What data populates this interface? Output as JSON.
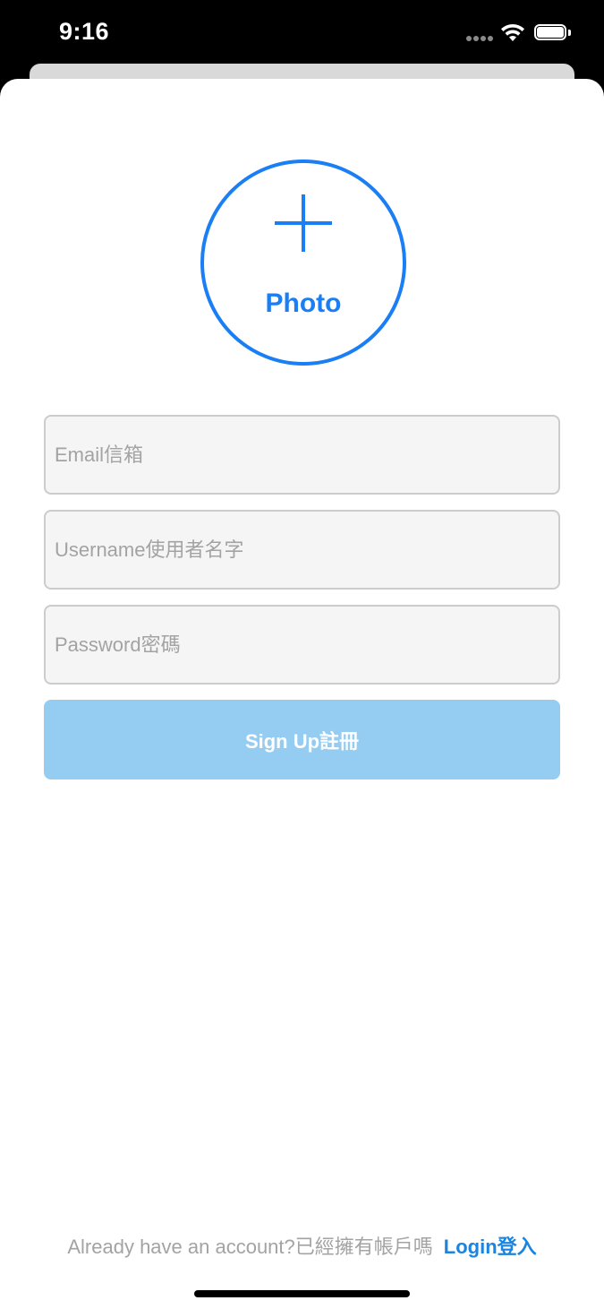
{
  "status_bar": {
    "time": "9:16"
  },
  "photo_picker": {
    "icon": "plus-icon",
    "label": "Photo"
  },
  "form": {
    "email_placeholder": "Email信箱",
    "email_value": "",
    "username_placeholder": "Username使用者名字",
    "username_value": "",
    "password_placeholder": "Password密碼",
    "password_value": "",
    "signup_label": "Sign Up註冊"
  },
  "footer": {
    "prompt": "Already have an account?已經擁有帳戶嗎",
    "login_label": "Login登入"
  },
  "colors": {
    "accent": "#1a7ef5",
    "button_disabled": "#95ccf2",
    "field_background": "#f5f5f5",
    "field_border": "#cccccc",
    "placeholder_text": "#a3a3a3",
    "link": "#1a84e0"
  }
}
